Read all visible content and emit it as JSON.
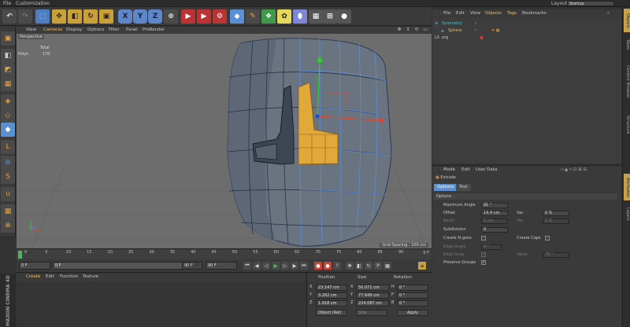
{
  "menubar": {
    "items": [
      "File",
      "Customization"
    ],
    "layout_label": "Layout:",
    "layout_value": "Startup"
  },
  "toolbar": {
    "axis_x": "X",
    "axis_y": "Y",
    "axis_z": "Z"
  },
  "viewport": {
    "menu": [
      "View",
      "Cameras",
      "Display",
      "Options",
      "Filter",
      "Panel",
      "ProRender"
    ],
    "camera_label": "Perspective",
    "stats_header": "Total",
    "stats_polys_label": "Polys",
    "stats_polys_value": "170",
    "grid_spacing": "Grid Spacing : 100 cm"
  },
  "timeline": {
    "ticks": [
      "0",
      "5",
      "10",
      "15",
      "20",
      "25",
      "30",
      "35",
      "40",
      "45",
      "50",
      "55",
      "60",
      "65",
      "70",
      "75",
      "80",
      "85",
      "90"
    ],
    "frame": "0 F"
  },
  "playback": {
    "start": "0 F",
    "current": "0 F",
    "end": "90 F",
    "end2": "90 F"
  },
  "materials": {
    "menu": [
      "Create",
      "Edit",
      "Function",
      "Texture"
    ]
  },
  "branding": "MAXON CINEMA 4D",
  "coordinates": {
    "headers": [
      "Position",
      "Size",
      "Rotation"
    ],
    "rows": [
      {
        "axis": "X",
        "pos": "23.147 cm",
        "size_axis": "X",
        "size": "50.071 cm",
        "rot_axis": "H",
        "rot": "0 °"
      },
      {
        "axis": "Y",
        "pos": "3.262 cm",
        "size_axis": "Y",
        "size": "77.649 cm",
        "rot_axis": "P",
        "rot": "0 °"
      },
      {
        "axis": "Z",
        "pos": "1.918 cm",
        "size_axis": "Z",
        "size": "224.087 cm",
        "rot_axis": "B",
        "rot": "0 °"
      }
    ],
    "mode": "Object (Rel)",
    "size_mode": "Size",
    "apply": "Apply"
  },
  "object_manager": {
    "menu": [
      "File",
      "Edit",
      "View",
      "Objects",
      "Tags",
      "Bookmarks"
    ],
    "objects": [
      {
        "name": "Symmetry",
        "color": "#4fc3c8"
      },
      {
        "name": "Sphere",
        "color": "#e0c060"
      },
      {
        "name": "L0 .org",
        "color": "#cfcfcf"
      }
    ]
  },
  "attribute_manager": {
    "menu": [
      "Mode",
      "Edit",
      "User Data"
    ],
    "tool_name": "Extrude",
    "tabs": [
      "Options",
      "Tool"
    ],
    "section": "Options",
    "max_angle_label": "Maximum Angle",
    "max_angle_value": "91 °",
    "offset_label": "Offset",
    "offset_value": "14.4 cm",
    "var_label": "Var.",
    "var_value": "0 %",
    "bevel_label": "Bevel",
    "bevel_value": "0 cm",
    "var2_label": "Var.",
    "var2_value": "0 %",
    "subdivision_label": "Subdivision",
    "subdivision_value": "0",
    "create_ngons_label": "Create N-gons",
    "create_caps_label": "Create Caps",
    "edge_angle_label": "Edge Angle",
    "edge_angle_value": "0 °",
    "edge_snap_label": "Edge Snap",
    "value_label": "Value",
    "value_value": "75 °",
    "preserve_groups_label": "Preserve Groups",
    "preserve_check": "✓"
  },
  "right_tabs": [
    "Objects",
    "Takes",
    "Content Browser",
    "Structure",
    "Attributes",
    "Layers"
  ]
}
